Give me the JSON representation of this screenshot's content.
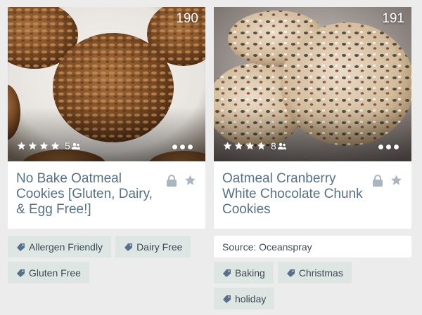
{
  "colors": {
    "page_background": "#ececec",
    "title_text": "#56708a",
    "tag_background": "#dde6e3",
    "action_icon": "#a9b5bf"
  },
  "cards": [
    {
      "number": "190",
      "stars": 4,
      "rating_count": "5",
      "title": "No Bake Oatmeal Cookies [Gluten, Dairy, & Egg Free!]",
      "source": null,
      "tags": [
        "Allergen Friendly",
        "Dairy Free",
        "Gluten Free"
      ],
      "icons": [
        "lock-icon",
        "star-icon",
        "tag-icon",
        "people-icon",
        "more-dots-icon"
      ]
    },
    {
      "number": "191",
      "stars": 4,
      "rating_count": "8",
      "title": "Oatmeal Cranberry White Chocolate Chunk Cookies",
      "source": "Source: Oceanspray",
      "tags": [
        "Baking",
        "Christmas",
        "holiday"
      ],
      "icons": [
        "lock-icon",
        "star-icon",
        "tag-icon",
        "people-icon",
        "more-dots-icon"
      ]
    }
  ]
}
